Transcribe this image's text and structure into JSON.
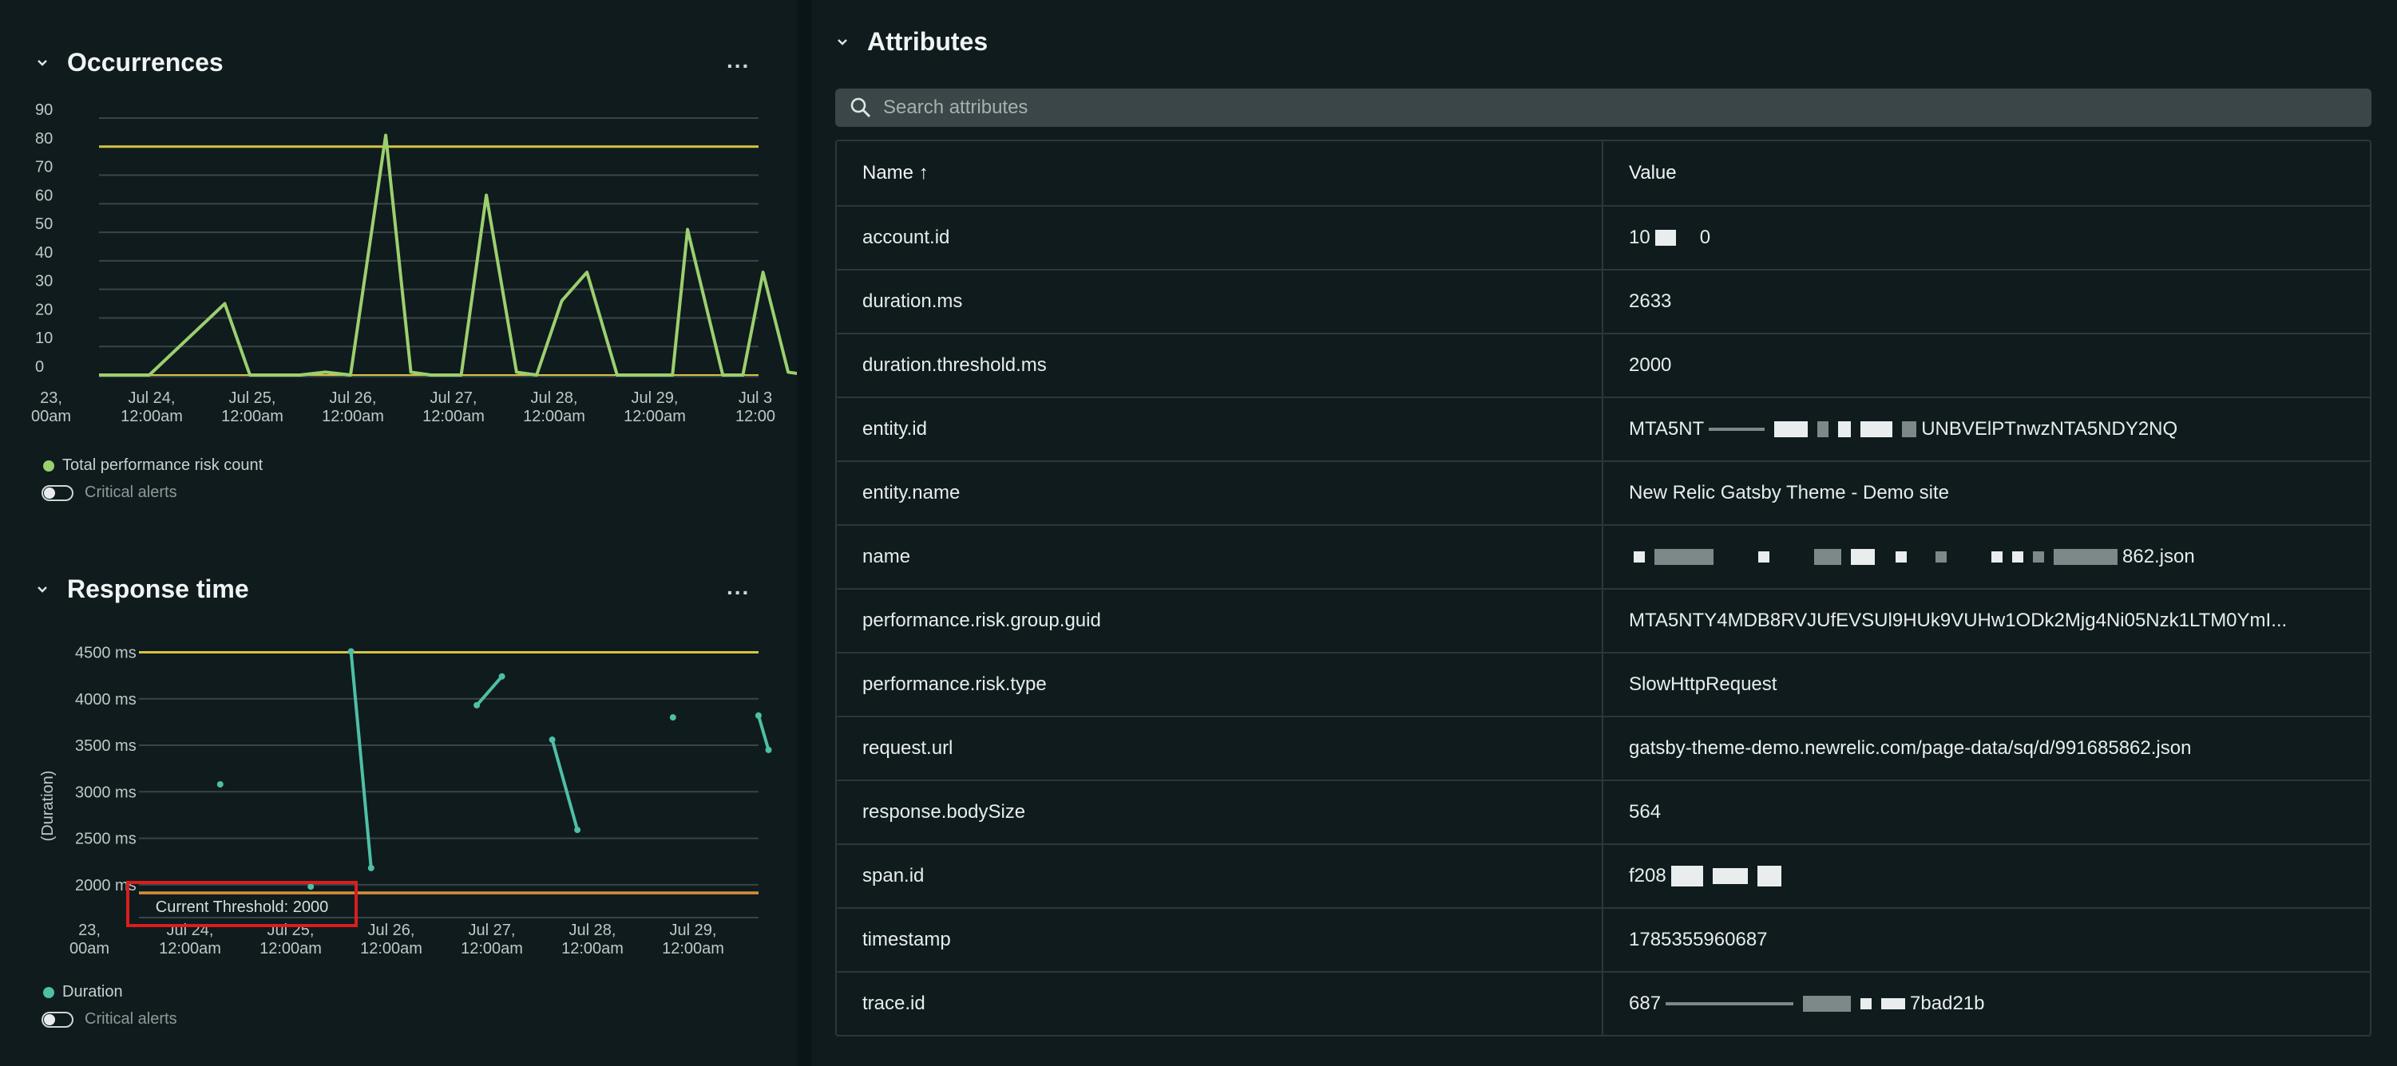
{
  "occurrences": {
    "title": "Occurrences",
    "more_label": "...",
    "legend": {
      "series_label": "Total performance risk count",
      "toggle_label": "Critical alerts"
    },
    "colors": {
      "series": "#9ccf6e",
      "threshold": "#d6c344",
      "grid": "#3a4547",
      "axis": "#bfc8c8"
    },
    "chart_data": {
      "type": "line",
      "ylim": [
        0,
        90
      ],
      "yticks": [
        "0",
        "10",
        "20",
        "30",
        "40",
        "50",
        "60",
        "70",
        "80",
        "90"
      ],
      "xticks": [
        {
          "l1": "23,",
          "l2": "00am"
        },
        {
          "l1": "Jul 24,",
          "l2": "12:00am"
        },
        {
          "l1": "Jul 25,",
          "l2": "12:00am"
        },
        {
          "l1": "Jul 26,",
          "l2": "12:00am"
        },
        {
          "l1": "Jul 27,",
          "l2": "12:00am"
        },
        {
          "l1": "Jul 28,",
          "l2": "12:00am"
        },
        {
          "l1": "Jul 29,",
          "l2": "12:00am"
        },
        {
          "l1": "Jul 3",
          "l2": "12:00"
        }
      ],
      "series": [
        {
          "name": "Total performance risk count",
          "points": [
            [
              0,
              0
            ],
            [
              0.5,
              0
            ],
            [
              1.25,
              25
            ],
            [
              1.5,
              0
            ],
            [
              2,
              0
            ],
            [
              2.25,
              1
            ],
            [
              2.5,
              0
            ],
            [
              2.85,
              84
            ],
            [
              3.1,
              1
            ],
            [
              3.3,
              0
            ],
            [
              3.6,
              0
            ],
            [
              3.85,
              63
            ],
            [
              4.15,
              1
            ],
            [
              4.35,
              0
            ],
            [
              4.6,
              26
            ],
            [
              4.85,
              36
            ],
            [
              5.15,
              0
            ],
            [
              5.4,
              0
            ],
            [
              5.7,
              0
            ],
            [
              5.85,
              51
            ],
            [
              6.2,
              0
            ],
            [
              6.4,
              0
            ],
            [
              6.6,
              36
            ],
            [
              6.85,
              1
            ],
            [
              7.05,
              0
            ]
          ]
        }
      ],
      "threshold": 80,
      "baseline": 0
    }
  },
  "response_time": {
    "title": "Response time",
    "more_label": "...",
    "ylabel": "(Duration)",
    "legend": {
      "series_label": "Duration",
      "toggle_label": "Critical alerts"
    },
    "threshold_label": "Current Threshold: 2000",
    "colors": {
      "series": "#4fbfa7",
      "threshold": "#d6c344",
      "warn": "#d98a3a",
      "grid": "#3a4547",
      "axis": "#bfc8c8"
    },
    "chart_data": {
      "type": "line",
      "ylim": [
        1750,
        4650
      ],
      "yticks": [
        {
          "v": 2000,
          "l": "2000 ms"
        },
        {
          "v": 2500,
          "l": "2500 ms"
        },
        {
          "v": 3000,
          "l": "3000 ms"
        },
        {
          "v": 3500,
          "l": "3500 ms"
        },
        {
          "v": 4000,
          "l": "4000 ms"
        },
        {
          "v": 4500,
          "l": "4500 ms"
        }
      ],
      "xticks": [
        {
          "l1": "23,",
          "l2": "00am"
        },
        {
          "l1": "Jul 24,",
          "l2": "12:00am"
        },
        {
          "l1": "Jul 25,",
          "l2": "12:00am"
        },
        {
          "l1": "Jul 26,",
          "l2": "12:00am"
        },
        {
          "l1": "Jul 27,",
          "l2": "12:00am"
        },
        {
          "l1": "Jul 28,",
          "l2": "12:00am"
        },
        {
          "l1": "Jul 29,",
          "l2": "12:00am"
        }
      ],
      "segments": [
        [
          [
            2.6,
            4510
          ],
          [
            2.8,
            2180
          ]
        ],
        [
          [
            3.85,
            3930
          ],
          [
            4.1,
            4240
          ]
        ],
        [
          [
            4.6,
            3560
          ],
          [
            4.85,
            2590
          ]
        ],
        [
          [
            6.65,
            3820
          ],
          [
            6.75,
            3450
          ]
        ]
      ],
      "points": [
        [
          1.3,
          3080
        ],
        [
          2.2,
          1980
        ],
        [
          5.8,
          3800
        ]
      ],
      "threshold": 4500,
      "threshold_low": 2000,
      "warn": 1910
    }
  },
  "attributes": {
    "title": "Attributes",
    "search_placeholder": "Search attributes",
    "columns": {
      "name": "Name ↑",
      "value": "Value"
    },
    "rows": [
      {
        "name": "account.id",
        "value": "10",
        "value_end": "0"
      },
      {
        "name": "duration.ms",
        "value": "2633"
      },
      {
        "name": "duration.threshold.ms",
        "value": "2000"
      },
      {
        "name": "entity.id",
        "value": "MTA5NT",
        "value_end": "UNBVElPTnwzNTA5NDY2NQ"
      },
      {
        "name": "entity.name",
        "value": "New Relic Gatsby Theme - Demo site"
      },
      {
        "name": "name",
        "value": "",
        "value_end": "862.json"
      },
      {
        "name": "performance.risk.group.guid",
        "value": "MTA5NTY4MDB8RVJUfEVSUl9HUk9VUHw1ODk2Mjg4Ni05Nzk1LTM0YmI..."
      },
      {
        "name": "performance.risk.type",
        "value": "SlowHttpRequest"
      },
      {
        "name": "request.url",
        "value": "gatsby-theme-demo.newrelic.com/page-data/sq/d/991685862.json"
      },
      {
        "name": "response.bodySize",
        "value": "564"
      },
      {
        "name": "span.id",
        "value": "f208",
        "value_end": ""
      },
      {
        "name": "timestamp",
        "value": "1785355960687"
      },
      {
        "name": "trace.id",
        "value": "687",
        "value_end": "7bad21b"
      }
    ]
  }
}
